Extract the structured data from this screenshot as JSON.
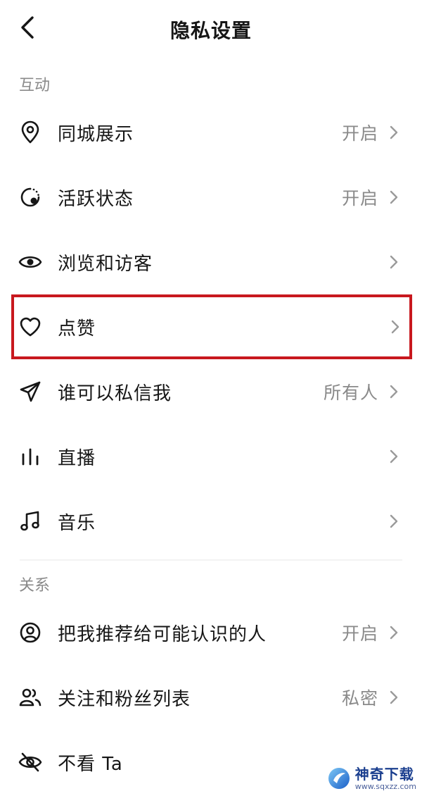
{
  "header": {
    "title": "隐私设置",
    "back_icon": "chevron-left-icon"
  },
  "sections": [
    {
      "title": "互动",
      "items": [
        {
          "label": "同城展示",
          "value": "开启",
          "icon": "location-pin-icon"
        },
        {
          "label": "活跃状态",
          "value": "开启",
          "icon": "active-status-icon"
        },
        {
          "label": "浏览和访客",
          "value": "",
          "icon": "eye-icon"
        },
        {
          "label": "点赞",
          "value": "",
          "icon": "heart-icon",
          "highlighted": true
        },
        {
          "label": "谁可以私信我",
          "value": "所有人",
          "icon": "paper-plane-icon"
        },
        {
          "label": "直播",
          "value": "",
          "icon": "live-bars-icon"
        },
        {
          "label": "音乐",
          "value": "",
          "icon": "music-note-icon"
        }
      ]
    },
    {
      "title": "关系",
      "items": [
        {
          "label": "把我推荐给可能认识的人",
          "value": "开启",
          "icon": "user-circle-icon"
        },
        {
          "label": "关注和粉丝列表",
          "value": "私密",
          "icon": "users-icon"
        },
        {
          "label": "不看 Ta",
          "value": "",
          "icon": "eye-off-icon"
        }
      ]
    }
  ],
  "watermark": {
    "name": "神奇下载",
    "url": "www.sqxzz.com"
  },
  "colors": {
    "highlight_border": "#c8181e",
    "secondary_text": "#8a8a8a",
    "primary_text": "#161616"
  }
}
